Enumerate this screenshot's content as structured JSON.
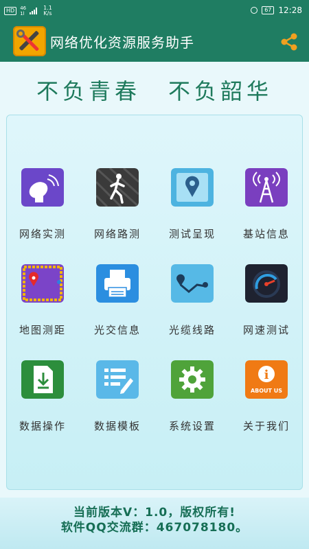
{
  "status_bar": {
    "hd": "HD",
    "network": "46",
    "network_sub": "1l",
    "speed_value": "1.1",
    "speed_unit": "K/s",
    "battery": "67",
    "time": "12:28"
  },
  "app_bar": {
    "title": "网络优化资源服务助手"
  },
  "slogan": {
    "left": "不负青春",
    "right": "不负韶华"
  },
  "menu": [
    {
      "label": "网络实测",
      "icon": "satellite-dish-icon"
    },
    {
      "label": "网络路测",
      "icon": "walking-person-icon"
    },
    {
      "label": "测试呈现",
      "icon": "map-pin-icon"
    },
    {
      "label": "基站信息",
      "icon": "base-station-tower-icon"
    },
    {
      "label": "地图测距",
      "icon": "map-distance-icon"
    },
    {
      "label": "光交信息",
      "icon": "printer-icon"
    },
    {
      "label": "光缆线路",
      "icon": "route-path-icon"
    },
    {
      "label": "网速测试",
      "icon": "speedometer-icon"
    },
    {
      "label": "数据操作",
      "icon": "download-document-icon"
    },
    {
      "label": "数据模板",
      "icon": "edit-list-icon"
    },
    {
      "label": "系统设置",
      "icon": "gear-icon"
    },
    {
      "label": "关于我们",
      "icon": "about-us-icon",
      "icon_text": "ABOUT US"
    }
  ],
  "footer": {
    "version": "当前版本V：1.0，版权所有!",
    "qq_group": "软件QQ交流群：467078180。"
  },
  "colors": {
    "app_bar": "#1f7d62",
    "slogan": "#1e7a5c",
    "background": "#e9f8fb",
    "logo": "#f2a500"
  }
}
